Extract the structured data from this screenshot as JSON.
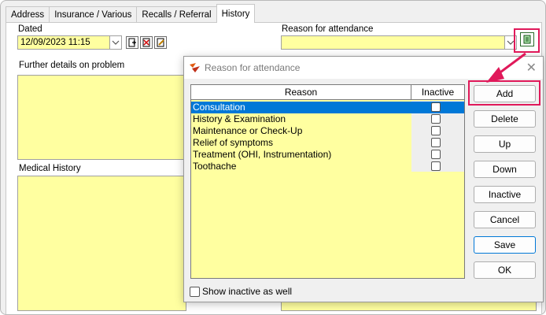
{
  "tabs": [
    {
      "label": "Address"
    },
    {
      "label": "Insurance / Various"
    },
    {
      "label": "Recalls / Referral"
    },
    {
      "label": "History"
    }
  ],
  "history": {
    "dated_label": "Dated",
    "dated_value": "12/09/2023 11:15",
    "reason_label": "Reason for attendance",
    "reason_value": "",
    "further_details_label": "Further details on problem",
    "medical_history_label": "Medical History"
  },
  "dialog": {
    "title": "Reason for attendance",
    "columns": {
      "reason": "Reason",
      "inactive": "Inactive"
    },
    "rows": [
      {
        "reason": "Consultation",
        "inactive": false,
        "selected": true
      },
      {
        "reason": "History & Examination",
        "inactive": false,
        "selected": false
      },
      {
        "reason": "Maintenance or Check-Up",
        "inactive": false,
        "selected": false
      },
      {
        "reason": "Relief of symptoms",
        "inactive": false,
        "selected": false
      },
      {
        "reason": "Treatment (OHI, Instrumentation)",
        "inactive": false,
        "selected": false
      },
      {
        "reason": "Toothache",
        "inactive": false,
        "selected": false
      }
    ],
    "show_inactive_label": "Show inactive as well",
    "show_inactive_checked": false,
    "buttons": {
      "add": "Add",
      "delete": "Delete",
      "up": "Up",
      "down": "Down",
      "inactive": "Inactive",
      "cancel": "Cancel",
      "save": "Save",
      "ok": "OK"
    }
  },
  "colors": {
    "field_yellow": "#ffffa0",
    "selection_blue": "#0078d7",
    "highlight_pink": "#e0195a"
  }
}
